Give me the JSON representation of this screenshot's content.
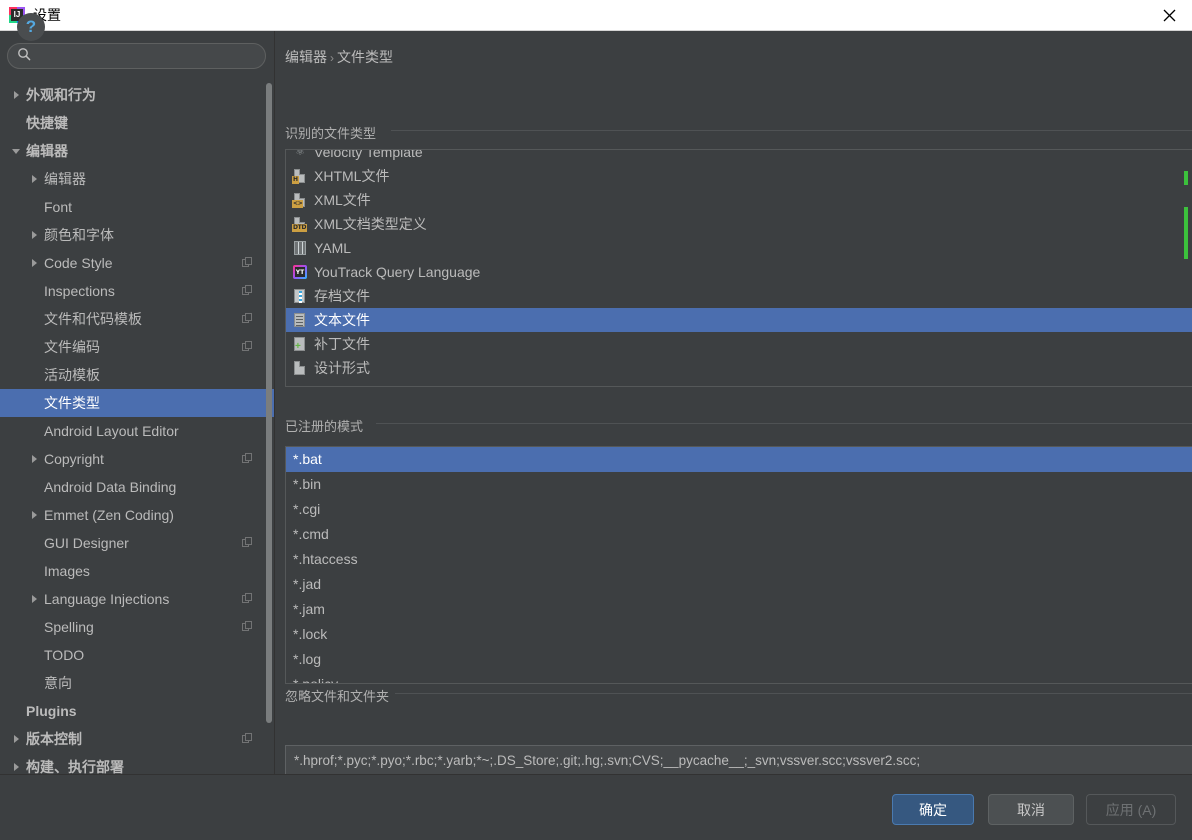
{
  "window": {
    "title": "设置",
    "app_icon": "jetbrains-logo-icon",
    "close_icon": "close-icon"
  },
  "sidebar": {
    "search": {
      "value": "",
      "placeholder": "",
      "icon": "search-icon"
    },
    "items": [
      {
        "label": "外观和行为",
        "indent": 0,
        "arrow": "right",
        "bold": true,
        "selected": false,
        "copy": false
      },
      {
        "label": "快捷键",
        "indent": 0,
        "arrow": "none",
        "bold": true,
        "selected": false,
        "copy": false
      },
      {
        "label": "编辑器",
        "indent": 0,
        "arrow": "down",
        "bold": true,
        "selected": false,
        "copy": false
      },
      {
        "label": "编辑器",
        "indent": 1,
        "arrow": "right",
        "bold": false,
        "selected": false,
        "copy": false
      },
      {
        "label": "Font",
        "indent": 1,
        "arrow": "none",
        "bold": false,
        "selected": false,
        "copy": false
      },
      {
        "label": "颜色和字体",
        "indent": 1,
        "arrow": "right",
        "bold": false,
        "selected": false,
        "copy": false
      },
      {
        "label": "Code Style",
        "indent": 1,
        "arrow": "right",
        "bold": false,
        "selected": false,
        "copy": true
      },
      {
        "label": "Inspections",
        "indent": 1,
        "arrow": "none",
        "bold": false,
        "selected": false,
        "copy": true
      },
      {
        "label": "文件和代码模板",
        "indent": 1,
        "arrow": "none",
        "bold": false,
        "selected": false,
        "copy": true
      },
      {
        "label": "文件编码",
        "indent": 1,
        "arrow": "none",
        "bold": false,
        "selected": false,
        "copy": true
      },
      {
        "label": "活动模板",
        "indent": 1,
        "arrow": "none",
        "bold": false,
        "selected": false,
        "copy": false
      },
      {
        "label": "文件类型",
        "indent": 1,
        "arrow": "none",
        "bold": false,
        "selected": true,
        "copy": false
      },
      {
        "label": "Android Layout Editor",
        "indent": 1,
        "arrow": "none",
        "bold": false,
        "selected": false,
        "copy": false
      },
      {
        "label": "Copyright",
        "indent": 1,
        "arrow": "right",
        "bold": false,
        "selected": false,
        "copy": true
      },
      {
        "label": "Android Data Binding",
        "indent": 1,
        "arrow": "none",
        "bold": false,
        "selected": false,
        "copy": false
      },
      {
        "label": "Emmet (Zen Coding)",
        "indent": 1,
        "arrow": "right",
        "bold": false,
        "selected": false,
        "copy": false
      },
      {
        "label": "GUI Designer",
        "indent": 1,
        "arrow": "none",
        "bold": false,
        "selected": false,
        "copy": true
      },
      {
        "label": "Images",
        "indent": 1,
        "arrow": "none",
        "bold": false,
        "selected": false,
        "copy": false
      },
      {
        "label": "Language Injections",
        "indent": 1,
        "arrow": "right",
        "bold": false,
        "selected": false,
        "copy": true
      },
      {
        "label": "Spelling",
        "indent": 1,
        "arrow": "none",
        "bold": false,
        "selected": false,
        "copy": true
      },
      {
        "label": "TODO",
        "indent": 1,
        "arrow": "none",
        "bold": false,
        "selected": false,
        "copy": false
      },
      {
        "label": "意向",
        "indent": 1,
        "arrow": "none",
        "bold": false,
        "selected": false,
        "copy": false
      },
      {
        "label": "Plugins",
        "indent": 0,
        "arrow": "none",
        "bold": true,
        "selected": false,
        "copy": false
      },
      {
        "label": "版本控制",
        "indent": 0,
        "arrow": "right",
        "bold": true,
        "selected": false,
        "copy": true
      },
      {
        "label": "构建、执行部署",
        "indent": 0,
        "arrow": "right",
        "bold": true,
        "selected": false,
        "copy": false
      }
    ]
  },
  "breadcrumb": {
    "parent": "编辑器",
    "separator": "›",
    "current": "文件类型"
  },
  "filetypes_section": {
    "title": "识别的文件类型",
    "items": [
      {
        "label": "Velocity Template",
        "icon": "velocity-icon",
        "tag": "",
        "partial": true,
        "selected": false
      },
      {
        "label": "XHTML文件",
        "icon": "xhtml-file-icon",
        "tag": "H",
        "partial": false,
        "selected": false
      },
      {
        "label": "XML文件",
        "icon": "xml-file-icon",
        "tag": "<>",
        "partial": false,
        "selected": false
      },
      {
        "label": "XML文档类型定义",
        "icon": "dtd-file-icon",
        "tag": "DTD",
        "partial": false,
        "selected": false
      },
      {
        "label": "YAML",
        "icon": "yaml-file-icon",
        "tag": "",
        "partial": false,
        "selected": false
      },
      {
        "label": "YouTrack Query Language",
        "icon": "youtrack-icon",
        "tag": "",
        "partial": false,
        "selected": false
      },
      {
        "label": "存档文件",
        "icon": "archive-file-icon",
        "tag": "",
        "partial": false,
        "selected": false
      },
      {
        "label": "文本文件",
        "icon": "text-file-icon",
        "tag": "",
        "partial": false,
        "selected": true
      },
      {
        "label": "补丁文件",
        "icon": "patch-file-icon",
        "tag": "",
        "partial": false,
        "selected": false
      },
      {
        "label": "设计形式",
        "icon": "form-file-icon",
        "tag": "",
        "partial": false,
        "selected": false
      }
    ],
    "toolbar": [
      {
        "name": "add-filetype-button",
        "icon": "plus-icon",
        "enabled": true
      },
      {
        "name": "remove-filetype-button",
        "icon": "minus-icon",
        "enabled": false
      },
      {
        "name": "edit-filetype-button",
        "icon": "pencil-icon",
        "enabled": false
      }
    ]
  },
  "patterns_section": {
    "title": "已注册的模式",
    "items": [
      {
        "label": "*.bat",
        "selected": true
      },
      {
        "label": "*.bin",
        "selected": false
      },
      {
        "label": "*.cgi",
        "selected": false
      },
      {
        "label": "*.cmd",
        "selected": false
      },
      {
        "label": "*.htaccess",
        "selected": false
      },
      {
        "label": "*.jad",
        "selected": false
      },
      {
        "label": "*.jam",
        "selected": false
      },
      {
        "label": "*.lock",
        "selected": false
      },
      {
        "label": "*.log",
        "selected": false
      },
      {
        "label": "*.policy",
        "selected": false
      }
    ],
    "toolbar": [
      {
        "name": "add-pattern-button",
        "icon": "plus-icon",
        "enabled": true
      },
      {
        "name": "remove-pattern-button",
        "icon": "minus-icon",
        "enabled": true
      },
      {
        "name": "edit-pattern-button",
        "icon": "pencil-icon",
        "enabled": true
      }
    ]
  },
  "ignore_section": {
    "title": "忽略文件和文件夹",
    "value": "*.hprof;*.pyc;*.pyo;*.rbc;*.yarb;*~;.DS_Store;.git;.hg;.svn;CVS;__pycache__;_svn;vssver.scc;vssver2.scc;",
    "placeholder": ""
  },
  "footer": {
    "help_label": "?",
    "ok_label": "确定",
    "cancel_label": "取消",
    "apply_label": "应用 (A)"
  },
  "colors": {
    "selection_blue": "#4b6eaf",
    "window_bg": "#3c3f41",
    "ok_button": "#365880",
    "accent_green": "#62b543",
    "accent_red": "#c75450",
    "help_icon": "#54a8e0"
  }
}
